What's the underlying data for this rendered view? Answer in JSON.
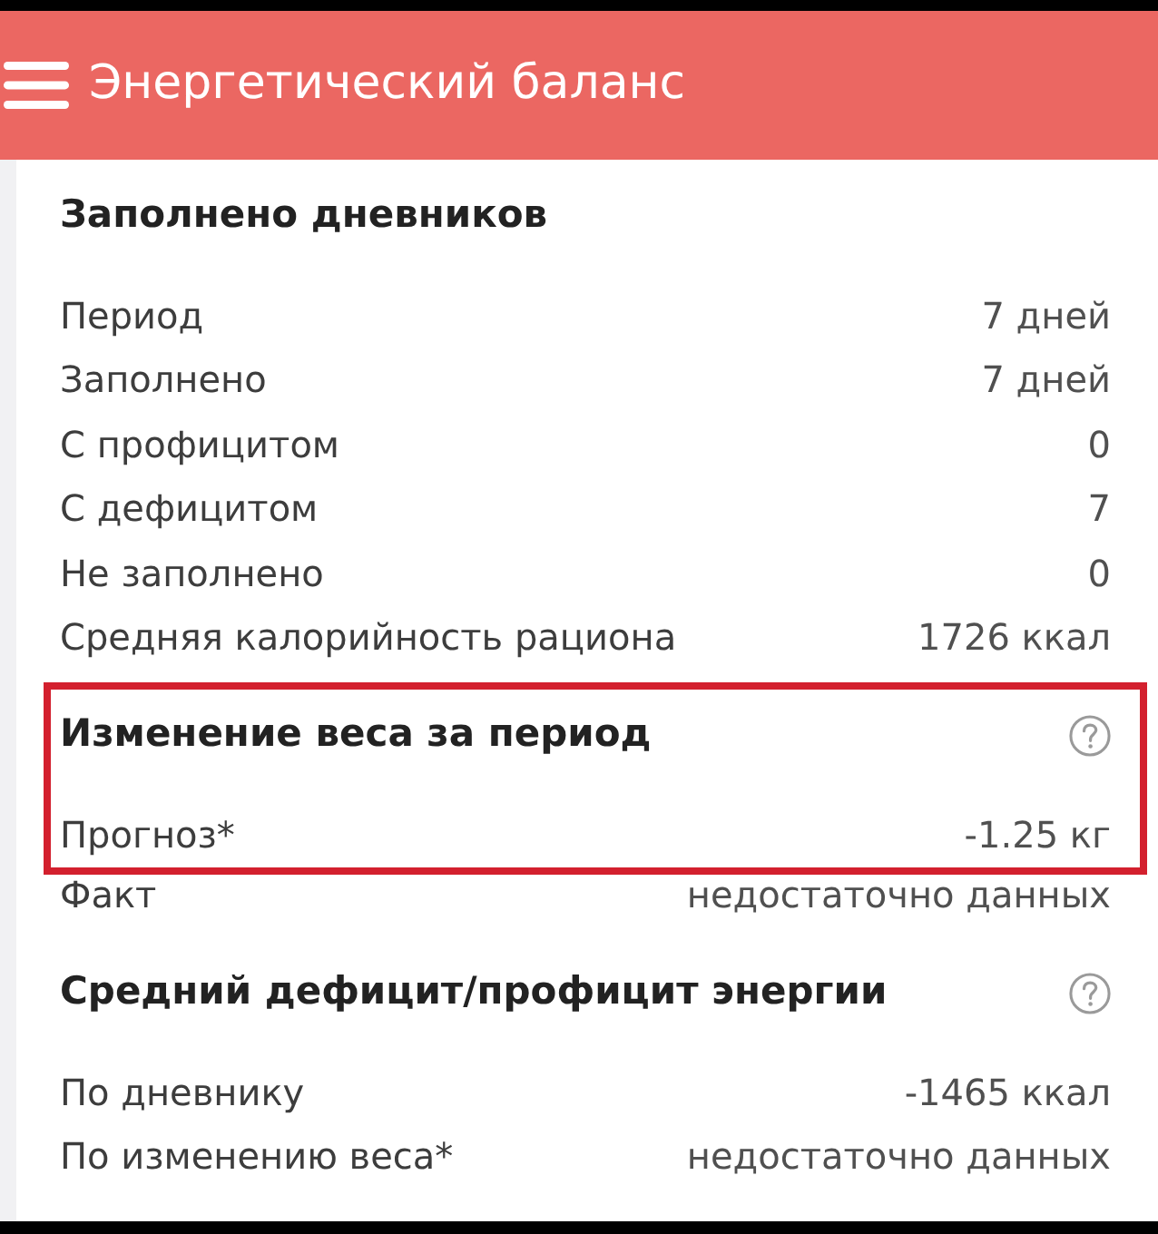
{
  "header": {
    "title": "Энергетический баланс"
  },
  "sections": [
    {
      "title": "Заполнено дневников",
      "help": false,
      "highlighted": false,
      "rows": [
        {
          "label": "Период",
          "value": "7 дней",
          "highlighted": false
        },
        {
          "label": "Заполнено",
          "value": "7 дней",
          "highlighted": false
        },
        {
          "label": "С профицитом",
          "value": "0",
          "highlighted": false
        },
        {
          "label": "С дефицитом",
          "value": "7",
          "highlighted": false
        },
        {
          "label": "Не заполнено",
          "value": "0",
          "highlighted": false
        },
        {
          "label": "Средняя калорийность рациона",
          "value": "1726 ккал",
          "highlighted": false
        }
      ]
    },
    {
      "title": "Изменение веса за период",
      "help": true,
      "highlighted": true,
      "rows": [
        {
          "label": "Прогноз*",
          "value": "-1.25 кг",
          "highlighted": true
        },
        {
          "label": "Факт",
          "value": "недостаточно данных",
          "highlighted": false
        }
      ]
    },
    {
      "title": "Средний дефицит/профицит энергии",
      "help": true,
      "highlighted": false,
      "rows": [
        {
          "label": "По дневнику",
          "value": "-1465 ккал",
          "highlighted": false
        },
        {
          "label": "По изменению веса*",
          "value": "недостаточно данных",
          "highlighted": false
        }
      ]
    }
  ]
}
